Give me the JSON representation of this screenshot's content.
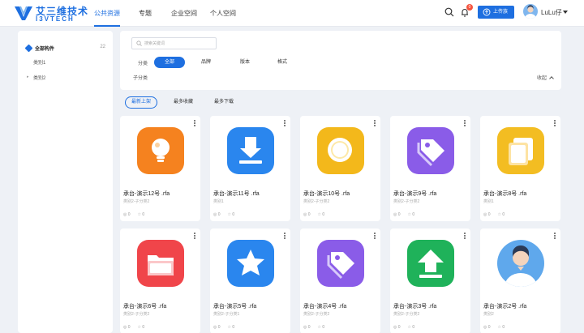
{
  "header": {
    "brand_cn": "艾三维技术",
    "brand_en": "I3VTECH",
    "nav": [
      "公共资源",
      "专题",
      "企业空间",
      "个人空间"
    ],
    "active_nav": 0,
    "bell_badge": "0",
    "upload_label": "上传族",
    "user_name": "LuLu仔"
  },
  "sidebar": {
    "all_label": "全部构件",
    "all_count": "22",
    "categories": [
      "类别1",
      "类别2"
    ]
  },
  "filter": {
    "search_placeholder": "搜索关键词",
    "row_label": "分类",
    "tags": [
      "全部",
      "品牌",
      "版本",
      "格式"
    ],
    "active_tag": 0,
    "sub_label": "子分类",
    "collapse_label": "收起"
  },
  "sort_tabs": [
    "最新上架",
    "最多收藏",
    "最多下载"
  ],
  "active_sort": 0,
  "colors": {
    "accent": "#1e6fe0",
    "badge": "#f5533d"
  },
  "cards": [
    {
      "title": "承台-演示12号 .rfa",
      "category": "类别2-子分类2",
      "views": "0",
      "stars": "0",
      "icon": "lightbulb-icon",
      "color": "#f5821f"
    },
    {
      "title": "承台-演示11号 .rfa",
      "category": "类别1",
      "views": "0",
      "stars": "0",
      "icon": "download-icon",
      "color": "#2a86ee"
    },
    {
      "title": "承台-演示10号 .rfa",
      "category": "类别2-子分类2",
      "views": "0",
      "stars": "0",
      "icon": "magnifier-icon",
      "color": "#f3b81b"
    },
    {
      "title": "承台-演示9号 .rfa",
      "category": "类别2-子分类2",
      "views": "0",
      "stars": "0",
      "icon": "tag-icon",
      "color": "#8a5ce8"
    },
    {
      "title": "承台-演示8号 .rfa",
      "category": "类别1",
      "views": "0",
      "stars": "0",
      "icon": "pages-icon",
      "color": "#f3bd22"
    },
    {
      "title": "承台-演示6号 .rfa",
      "category": "类别2-子分类2",
      "views": "0",
      "stars": "0",
      "icon": "folder-icon",
      "color": "#f0454a"
    },
    {
      "title": "承台-演示5号 .rfa",
      "category": "类别2-子分类1",
      "views": "0",
      "stars": "0",
      "icon": "star-icon",
      "color": "#2a86ee"
    },
    {
      "title": "承台-演示4号 .rfa",
      "category": "类别2-子分类2",
      "views": "0",
      "stars": "0",
      "icon": "tag-icon",
      "color": "#8a5ce8"
    },
    {
      "title": "承台-演示3号 .rfa",
      "category": "类别2-子分类2",
      "views": "0",
      "stars": "0",
      "icon": "upload-arrow-icon",
      "color": "#1fb25a"
    },
    {
      "title": "承台-演示2号 .rfa",
      "category": "类别2",
      "views": "0",
      "stars": "0",
      "icon": "user-avatar-icon",
      "color": "#5fa8ec"
    }
  ]
}
